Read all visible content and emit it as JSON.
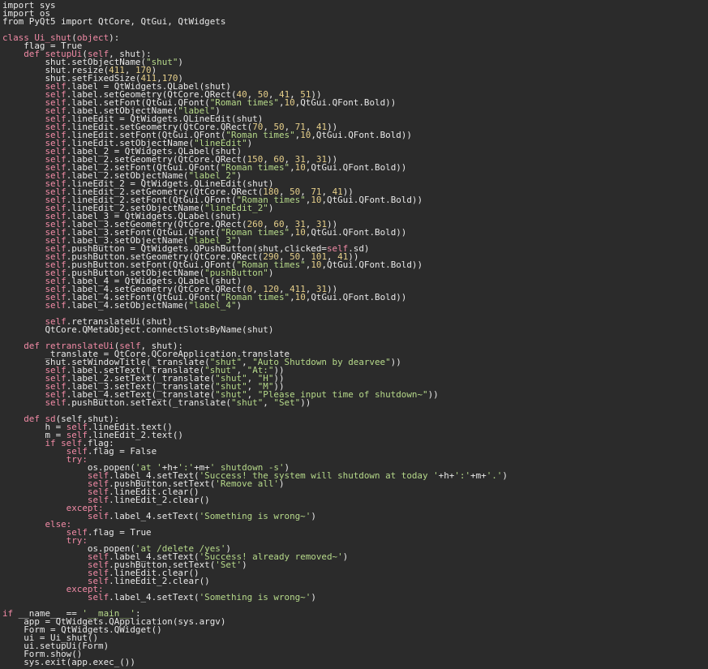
{
  "lines": [
    [
      [
        "tx",
        "import sys"
      ]
    ],
    [
      [
        "tx",
        "import os"
      ]
    ],
    [
      [
        "tx",
        "from PyQt5 import QtCore, QtGui, QtWidgets"
      ]
    ],
    [],
    [
      [
        "kw",
        "class "
      ],
      [
        "fn",
        "Ui_shut"
      ],
      [
        "tx",
        "("
      ],
      [
        "kw",
        "object"
      ],
      [
        "tx",
        "):"
      ]
    ],
    [
      [
        "tx",
        "    flag = True"
      ]
    ],
    [
      [
        "tx",
        "    "
      ],
      [
        "kw",
        "def "
      ],
      [
        "fn",
        "setupUi"
      ],
      [
        "tx",
        "("
      ],
      [
        "self",
        "self"
      ],
      [
        "tx",
        ", shut):"
      ]
    ],
    [
      [
        "tx",
        "        shut.setObjectName("
      ],
      [
        "str",
        "\"shut\""
      ],
      [
        "tx",
        ")"
      ]
    ],
    [
      [
        "tx",
        "        shut.resize("
      ],
      [
        "num",
        "411"
      ],
      [
        "tx",
        ", "
      ],
      [
        "num",
        "170"
      ],
      [
        "tx",
        ")"
      ]
    ],
    [
      [
        "tx",
        "        shut.setFixedSize("
      ],
      [
        "num",
        "411"
      ],
      [
        "tx",
        ","
      ],
      [
        "num",
        "170"
      ],
      [
        "tx",
        ")"
      ]
    ],
    [
      [
        "self",
        "        self"
      ],
      [
        "tx",
        ".label = QtWidgets.QLabel(shut)"
      ]
    ],
    [
      [
        "self",
        "        self"
      ],
      [
        "tx",
        ".label.setGeometry(QtCore.QRect("
      ],
      [
        "num",
        "40"
      ],
      [
        "tx",
        ", "
      ],
      [
        "num",
        "50"
      ],
      [
        "tx",
        ", "
      ],
      [
        "num",
        "41"
      ],
      [
        "tx",
        ", "
      ],
      [
        "num",
        "51"
      ],
      [
        "tx",
        "))"
      ]
    ],
    [
      [
        "self",
        "        self"
      ],
      [
        "tx",
        ".label.setFont(QtGui.QFont("
      ],
      [
        "str",
        "\"Roman times\""
      ],
      [
        "tx",
        ","
      ],
      [
        "num",
        "10"
      ],
      [
        "tx",
        ",QtGui.QFont.Bold))"
      ]
    ],
    [
      [
        "self",
        "        self"
      ],
      [
        "tx",
        ".label.setObjectName("
      ],
      [
        "str",
        "\"label\""
      ],
      [
        "tx",
        ")"
      ]
    ],
    [
      [
        "self",
        "        self"
      ],
      [
        "tx",
        ".lineEdit = QtWidgets.QLineEdit(shut)"
      ]
    ],
    [
      [
        "self",
        "        self"
      ],
      [
        "tx",
        ".lineEdit.setGeometry(QtCore.QRect("
      ],
      [
        "num",
        "70"
      ],
      [
        "tx",
        ", "
      ],
      [
        "num",
        "50"
      ],
      [
        "tx",
        ", "
      ],
      [
        "num",
        "71"
      ],
      [
        "tx",
        ", "
      ],
      [
        "num",
        "41"
      ],
      [
        "tx",
        "))"
      ]
    ],
    [
      [
        "self",
        "        self"
      ],
      [
        "tx",
        ".lineEdit.setFont(QtGui.QFont("
      ],
      [
        "str",
        "\"Roman times\""
      ],
      [
        "tx",
        ","
      ],
      [
        "num",
        "10"
      ],
      [
        "tx",
        ",QtGui.QFont.Bold))"
      ]
    ],
    [
      [
        "self",
        "        self"
      ],
      [
        "tx",
        ".lineEdit.setObjectName("
      ],
      [
        "str",
        "\"lineEdit\""
      ],
      [
        "tx",
        ")"
      ]
    ],
    [
      [
        "self",
        "        self"
      ],
      [
        "tx",
        ".label_2 = QtWidgets.QLabel(shut)"
      ]
    ],
    [
      [
        "self",
        "        self"
      ],
      [
        "tx",
        ".label_2.setGeometry(QtCore.QRect("
      ],
      [
        "num",
        "150"
      ],
      [
        "tx",
        ", "
      ],
      [
        "num",
        "60"
      ],
      [
        "tx",
        ", "
      ],
      [
        "num",
        "31"
      ],
      [
        "tx",
        ", "
      ],
      [
        "num",
        "31"
      ],
      [
        "tx",
        "))"
      ]
    ],
    [
      [
        "self",
        "        self"
      ],
      [
        "tx",
        ".label_2.setFont(QtGui.QFont("
      ],
      [
        "str",
        "\"Roman times\""
      ],
      [
        "tx",
        ","
      ],
      [
        "num",
        "10"
      ],
      [
        "tx",
        ",QtGui.QFont.Bold))"
      ]
    ],
    [
      [
        "self",
        "        self"
      ],
      [
        "tx",
        ".label_2.setObjectName("
      ],
      [
        "str",
        "\"label_2\""
      ],
      [
        "tx",
        ")"
      ]
    ],
    [
      [
        "self",
        "        self"
      ],
      [
        "tx",
        ".lineEdit_2 = QtWidgets.QLineEdit(shut)"
      ]
    ],
    [
      [
        "self",
        "        self"
      ],
      [
        "tx",
        ".lineEdit_2.setGeometry(QtCore.QRect("
      ],
      [
        "num",
        "180"
      ],
      [
        "tx",
        ", "
      ],
      [
        "num",
        "50"
      ],
      [
        "tx",
        ", "
      ],
      [
        "num",
        "71"
      ],
      [
        "tx",
        ", "
      ],
      [
        "num",
        "41"
      ],
      [
        "tx",
        "))"
      ]
    ],
    [
      [
        "self",
        "        self"
      ],
      [
        "tx",
        ".lineEdit_2.setFont(QtGui.QFont("
      ],
      [
        "str",
        "\"Roman times\""
      ],
      [
        "tx",
        ","
      ],
      [
        "num",
        "10"
      ],
      [
        "tx",
        ",QtGui.QFont.Bold))"
      ]
    ],
    [
      [
        "self",
        "        self"
      ],
      [
        "tx",
        ".lineEdit_2.setObjectName("
      ],
      [
        "str",
        "\"lineEdit_2\""
      ],
      [
        "tx",
        ")"
      ]
    ],
    [
      [
        "self",
        "        self"
      ],
      [
        "tx",
        ".label_3 = QtWidgets.QLabel(shut)"
      ]
    ],
    [
      [
        "self",
        "        self"
      ],
      [
        "tx",
        ".label_3.setGeometry(QtCore.QRect("
      ],
      [
        "num",
        "260"
      ],
      [
        "tx",
        ", "
      ],
      [
        "num",
        "60"
      ],
      [
        "tx",
        ", "
      ],
      [
        "num",
        "31"
      ],
      [
        "tx",
        ", "
      ],
      [
        "num",
        "31"
      ],
      [
        "tx",
        "))"
      ]
    ],
    [
      [
        "self",
        "        self"
      ],
      [
        "tx",
        ".label_3.setFont(QtGui.QFont("
      ],
      [
        "str",
        "\"Roman times\""
      ],
      [
        "tx",
        ","
      ],
      [
        "num",
        "10"
      ],
      [
        "tx",
        ",QtGui.QFont.Bold))"
      ]
    ],
    [
      [
        "self",
        "        self"
      ],
      [
        "tx",
        ".label_3.setObjectName("
      ],
      [
        "str",
        "\"label_3\""
      ],
      [
        "tx",
        ")"
      ]
    ],
    [
      [
        "self",
        "        self"
      ],
      [
        "tx",
        ".pushButton = QtWidgets.QPushButton(shut,clicked="
      ],
      [
        "self",
        "self"
      ],
      [
        "tx",
        ".sd)"
      ]
    ],
    [
      [
        "self",
        "        self"
      ],
      [
        "tx",
        ".pushButton.setGeometry(QtCore.QRect("
      ],
      [
        "num",
        "290"
      ],
      [
        "tx",
        ", "
      ],
      [
        "num",
        "50"
      ],
      [
        "tx",
        ", "
      ],
      [
        "num",
        "101"
      ],
      [
        "tx",
        ", "
      ],
      [
        "num",
        "41"
      ],
      [
        "tx",
        "))"
      ]
    ],
    [
      [
        "self",
        "        self"
      ],
      [
        "tx",
        ".pushButton.setFont(QtGui.QFont("
      ],
      [
        "str",
        "\"Roman times\""
      ],
      [
        "tx",
        ","
      ],
      [
        "num",
        "10"
      ],
      [
        "tx",
        ",QtGui.QFont.Bold))"
      ]
    ],
    [
      [
        "self",
        "        self"
      ],
      [
        "tx",
        ".pushButton.setObjectName("
      ],
      [
        "str",
        "\"pushButton\""
      ],
      [
        "tx",
        ")"
      ]
    ],
    [
      [
        "self",
        "        self"
      ],
      [
        "tx",
        ".label_4 = QtWidgets.QLabel(shut)"
      ]
    ],
    [
      [
        "self",
        "        self"
      ],
      [
        "tx",
        ".label_4.setGeometry(QtCore.QRect("
      ],
      [
        "num",
        "0"
      ],
      [
        "tx",
        ", "
      ],
      [
        "num",
        "120"
      ],
      [
        "tx",
        ", "
      ],
      [
        "num",
        "411"
      ],
      [
        "tx",
        ", "
      ],
      [
        "num",
        "31"
      ],
      [
        "tx",
        "))"
      ]
    ],
    [
      [
        "self",
        "        self"
      ],
      [
        "tx",
        ".label_4.setFont(QtGui.QFont("
      ],
      [
        "str",
        "\"Roman times\""
      ],
      [
        "tx",
        ","
      ],
      [
        "num",
        "10"
      ],
      [
        "tx",
        ",QtGui.QFont.Bold))"
      ]
    ],
    [
      [
        "self",
        "        self"
      ],
      [
        "tx",
        ".label_4.setObjectName("
      ],
      [
        "str",
        "\"label_4\""
      ],
      [
        "tx",
        ")"
      ]
    ],
    [],
    [
      [
        "self",
        "        self"
      ],
      [
        "tx",
        ".retranslateUi(shut)"
      ]
    ],
    [
      [
        "tx",
        "        QtCore.QMetaObject.connectSlotsByName(shut)"
      ]
    ],
    [],
    [
      [
        "tx",
        "    "
      ],
      [
        "kw",
        "def "
      ],
      [
        "fn",
        "retranslateUi"
      ],
      [
        "tx",
        "("
      ],
      [
        "self",
        "self"
      ],
      [
        "tx",
        ", shut):"
      ]
    ],
    [
      [
        "tx",
        "        _translate = QtCore.QCoreApplication.translate"
      ]
    ],
    [
      [
        "tx",
        "        shut.setWindowTitle(_translate("
      ],
      [
        "str",
        "\"shut\""
      ],
      [
        "tx",
        ", "
      ],
      [
        "str",
        "\"Auto Shutdown by dearvee\""
      ],
      [
        "tx",
        "))"
      ]
    ],
    [
      [
        "self",
        "        self"
      ],
      [
        "tx",
        ".label.setText(_translate("
      ],
      [
        "str",
        "\"shut\""
      ],
      [
        "tx",
        ", "
      ],
      [
        "str",
        "\"At:\""
      ],
      [
        "tx",
        "))"
      ]
    ],
    [
      [
        "self",
        "        self"
      ],
      [
        "tx",
        ".label_2.setText(_translate("
      ],
      [
        "str",
        "\"shut\""
      ],
      [
        "tx",
        ", "
      ],
      [
        "str",
        "\"H\""
      ],
      [
        "tx",
        "))"
      ]
    ],
    [
      [
        "self",
        "        self"
      ],
      [
        "tx",
        ".label_3.setText(_translate("
      ],
      [
        "str",
        "\"shut\""
      ],
      [
        "tx",
        ", "
      ],
      [
        "str",
        "\"M\""
      ],
      [
        "tx",
        "))"
      ]
    ],
    [
      [
        "self",
        "        self"
      ],
      [
        "tx",
        ".label_4.setText(_translate("
      ],
      [
        "str",
        "\"shut\""
      ],
      [
        "tx",
        ", "
      ],
      [
        "str",
        "\"Please input time of shutdown~\""
      ],
      [
        "tx",
        "))"
      ]
    ],
    [
      [
        "self",
        "        self"
      ],
      [
        "tx",
        ".pushButton.setText(_translate("
      ],
      [
        "str",
        "\"shut\""
      ],
      [
        "tx",
        ", "
      ],
      [
        "str",
        "\"Set\""
      ],
      [
        "tx",
        "))"
      ]
    ],
    [],
    [
      [
        "tx",
        "    "
      ],
      [
        "kw",
        "def "
      ],
      [
        "fn",
        "sd"
      ],
      [
        "tx",
        "(self,shut):"
      ]
    ],
    [
      [
        "tx",
        "        h = "
      ],
      [
        "self",
        "self"
      ],
      [
        "tx",
        ".lineEdit.text()"
      ]
    ],
    [
      [
        "tx",
        "        m = "
      ],
      [
        "self",
        "self"
      ],
      [
        "tx",
        ".lineEdit_2.text()"
      ]
    ],
    [
      [
        "kw",
        "        if "
      ],
      [
        "self",
        "self"
      ],
      [
        "tx",
        ".flag:"
      ]
    ],
    [
      [
        "self",
        "            self"
      ],
      [
        "tx",
        ".flag = False"
      ]
    ],
    [
      [
        "kw",
        "            try:"
      ]
    ],
    [
      [
        "tx",
        "                os.popen("
      ],
      [
        "str",
        "'at '"
      ],
      [
        "tx",
        "+h+"
      ],
      [
        "str",
        "':'"
      ],
      [
        "tx",
        "+m+"
      ],
      [
        "str",
        "' shutdown -s'"
      ],
      [
        "tx",
        ")"
      ]
    ],
    [
      [
        "self",
        "                self"
      ],
      [
        "tx",
        ".label_4.setText("
      ],
      [
        "str",
        "'Success! the system will shutdown at today '"
      ],
      [
        "tx",
        "+h+"
      ],
      [
        "str",
        "':'"
      ],
      [
        "tx",
        "+m+"
      ],
      [
        "str",
        "'.'"
      ],
      [
        "tx",
        ")"
      ]
    ],
    [
      [
        "self",
        "                self"
      ],
      [
        "tx",
        ".pushButton.setText("
      ],
      [
        "str",
        "'Remove all'"
      ],
      [
        "tx",
        ")"
      ]
    ],
    [
      [
        "self",
        "                self"
      ],
      [
        "tx",
        ".lineEdit.clear()"
      ]
    ],
    [
      [
        "self",
        "                self"
      ],
      [
        "tx",
        ".lineEdit_2.clear()"
      ]
    ],
    [
      [
        "kw",
        "            except:"
      ]
    ],
    [
      [
        "self",
        "                self"
      ],
      [
        "tx",
        ".label_4.setText("
      ],
      [
        "str",
        "'Something is wrong~'"
      ],
      [
        "tx",
        ")"
      ]
    ],
    [
      [
        "kw",
        "        else:"
      ]
    ],
    [
      [
        "self",
        "            self"
      ],
      [
        "tx",
        ".flag = True"
      ]
    ],
    [
      [
        "kw",
        "            try:"
      ]
    ],
    [
      [
        "tx",
        "                os.popen("
      ],
      [
        "str",
        "'at /delete /yes'"
      ],
      [
        "tx",
        ")"
      ]
    ],
    [
      [
        "self",
        "                self"
      ],
      [
        "tx",
        ".label_4.setText("
      ],
      [
        "str",
        "'Success! already removed~'"
      ],
      [
        "tx",
        ")"
      ]
    ],
    [
      [
        "self",
        "                self"
      ],
      [
        "tx",
        ".pushButton.setText("
      ],
      [
        "str",
        "'Set'"
      ],
      [
        "tx",
        ")"
      ]
    ],
    [
      [
        "self",
        "                self"
      ],
      [
        "tx",
        ".lineEdit.clear()"
      ]
    ],
    [
      [
        "self",
        "                self"
      ],
      [
        "tx",
        ".lineEdit_2.clear()"
      ]
    ],
    [
      [
        "kw",
        "            except:"
      ]
    ],
    [
      [
        "self",
        "                self"
      ],
      [
        "tx",
        ".label_4.setText("
      ],
      [
        "str",
        "'Something is wrong~'"
      ],
      [
        "tx",
        ")"
      ]
    ],
    [],
    [
      [
        "kw",
        "if "
      ],
      [
        "tx",
        "__name__ == "
      ],
      [
        "str",
        "'__main__'"
      ],
      [
        "tx",
        ":"
      ]
    ],
    [
      [
        "tx",
        "    app = QtWidgets.QApplication(sys.argv)"
      ]
    ],
    [
      [
        "tx",
        "    Form = QtWidgets.QWidget()"
      ]
    ],
    [
      [
        "tx",
        "    ui = Ui_shut()"
      ]
    ],
    [
      [
        "tx",
        "    ui.setupUi(Form)"
      ]
    ],
    [
      [
        "tx",
        "    Form.show()"
      ]
    ],
    [
      [
        "tx",
        "    sys.exit(app.exec_())"
      ]
    ]
  ]
}
